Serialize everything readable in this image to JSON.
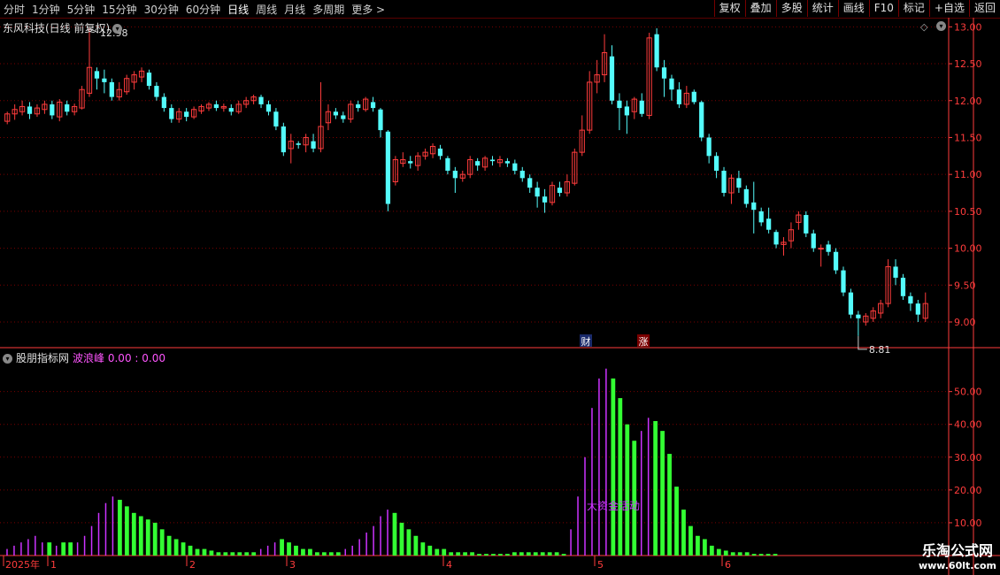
{
  "toolbar": {
    "periods": [
      "分时",
      "1分钟",
      "5分钟",
      "15分钟",
      "30分钟",
      "60分钟",
      "日线",
      "周线",
      "月线",
      "多周期",
      "更多 >"
    ],
    "active_period": "日线",
    "buttons": [
      "复权",
      "叠加",
      "多股",
      "统计",
      "画线",
      "F10",
      "标记",
      "+自选",
      "返回"
    ]
  },
  "stock": {
    "title": "东风科技(日线 前复权)",
    "high_label": "12.98",
    "low_label": "8.81",
    "marker_cai": "财",
    "marker_zhang": "涨"
  },
  "indicator": {
    "name": "股朋指标网",
    "sub": "波浪峰",
    "values": "0.00 : 0.00",
    "annotation": "大资金活动"
  },
  "colors": {
    "up": "#ff3c3c",
    "down": "#54fcfc",
    "axis": "#ff3c3c",
    "grid": "#7a0000",
    "bar_green": "#33ff33",
    "bar_purple": "#cc33ff"
  },
  "chart_data": [
    {
      "type": "candlestick",
      "y_axis": [
        "13.00",
        "12.50",
        "12.00",
        "11.50",
        "11.00",
        "10.50",
        "10.00",
        "9.50",
        "9.00"
      ],
      "ylim": [
        8.7,
        13.1
      ],
      "x_labels": [
        "2025年",
        "1",
        "2",
        "3",
        "4",
        "5",
        "6"
      ],
      "candles": [
        [
          11.72,
          11.82,
          11.68,
          11.85
        ],
        [
          11.82,
          11.88,
          11.74,
          11.95
        ],
        [
          11.85,
          11.92,
          11.8,
          12.0
        ],
        [
          11.92,
          11.82,
          11.75,
          11.98
        ],
        [
          11.82,
          11.9,
          11.78,
          11.95
        ],
        [
          11.88,
          11.95,
          11.82,
          12.0
        ],
        [
          11.95,
          11.8,
          11.75,
          12.0
        ],
        [
          11.78,
          11.98,
          11.72,
          12.02
        ],
        [
          11.95,
          11.85,
          11.8,
          12.0
        ],
        [
          11.85,
          11.92,
          11.8,
          11.96
        ],
        [
          11.9,
          12.15,
          11.88,
          12.2
        ],
        [
          12.1,
          12.45,
          12.05,
          12.98
        ],
        [
          12.4,
          12.3,
          12.15,
          12.45
        ],
        [
          12.3,
          12.25,
          12.1,
          12.42
        ],
        [
          12.25,
          12.05,
          12.0,
          12.3
        ],
        [
          12.05,
          12.15,
          12.0,
          12.25
        ],
        [
          12.12,
          12.3,
          12.08,
          12.35
        ],
        [
          12.25,
          12.35,
          12.15,
          12.4
        ],
        [
          12.32,
          12.4,
          12.25,
          12.45
        ],
        [
          12.38,
          12.2,
          12.15,
          12.42
        ],
        [
          12.2,
          12.05,
          12.0,
          12.25
        ],
        [
          12.05,
          11.9,
          11.85,
          12.1
        ],
        [
          11.9,
          11.75,
          11.7,
          11.95
        ],
        [
          11.75,
          11.85,
          11.7,
          11.9
        ],
        [
          11.85,
          11.78,
          11.72,
          11.9
        ],
        [
          11.78,
          11.88,
          11.75,
          11.92
        ],
        [
          11.86,
          11.92,
          11.82,
          11.95
        ],
        [
          11.9,
          11.95,
          11.86,
          11.98
        ],
        [
          11.95,
          11.9,
          11.86,
          12.0
        ],
        [
          11.9,
          11.92,
          11.85,
          11.96
        ],
        [
          11.9,
          11.85,
          11.8,
          11.95
        ],
        [
          11.85,
          11.95,
          11.82,
          12.0
        ],
        [
          11.95,
          12.0,
          11.9,
          12.05
        ],
        [
          12.0,
          12.05,
          11.95,
          12.08
        ],
        [
          12.05,
          11.95,
          11.9,
          12.08
        ],
        [
          11.95,
          11.85,
          11.8,
          12.0
        ],
        [
          11.85,
          11.65,
          11.6,
          11.9
        ],
        [
          11.65,
          11.3,
          11.25,
          11.7
        ],
        [
          11.35,
          11.45,
          11.15,
          11.55
        ],
        [
          11.42,
          11.4,
          11.35,
          11.45
        ],
        [
          11.4,
          11.5,
          11.3,
          11.55
        ],
        [
          11.45,
          11.35,
          11.3,
          11.55
        ],
        [
          11.35,
          11.65,
          11.3,
          12.25
        ],
        [
          11.7,
          11.85,
          11.6,
          11.95
        ],
        [
          11.85,
          11.8,
          11.75,
          11.9
        ],
        [
          11.8,
          11.75,
          11.7,
          11.85
        ],
        [
          11.75,
          11.95,
          11.7,
          12.0
        ],
        [
          11.95,
          11.9,
          11.85,
          12.0
        ],
        [
          11.88,
          12.02,
          11.85,
          12.05
        ],
        [
          11.98,
          11.9,
          11.85,
          12.05
        ],
        [
          11.88,
          11.6,
          11.5,
          11.9
        ],
        [
          11.58,
          10.6,
          10.5,
          11.6
        ],
        [
          10.9,
          11.2,
          10.85,
          11.25
        ],
        [
          11.15,
          11.2,
          11.1,
          11.3
        ],
        [
          11.18,
          11.15,
          11.08,
          11.25
        ],
        [
          11.12,
          11.25,
          11.05,
          11.3
        ],
        [
          11.25,
          11.3,
          11.2,
          11.35
        ],
        [
          11.28,
          11.38,
          11.22,
          11.42
        ],
        [
          11.35,
          11.25,
          11.2,
          11.4
        ],
        [
          11.22,
          11.05,
          11.0,
          11.25
        ],
        [
          11.05,
          10.95,
          10.75,
          11.1
        ],
        [
          10.95,
          11.0,
          10.9,
          11.05
        ],
        [
          11.0,
          11.2,
          10.95,
          11.25
        ],
        [
          11.18,
          11.12,
          11.05,
          11.22
        ],
        [
          11.1,
          11.22,
          11.05,
          11.25
        ],
        [
          11.2,
          11.18,
          11.12,
          11.25
        ],
        [
          11.16,
          11.2,
          11.1,
          11.25
        ],
        [
          11.18,
          11.15,
          11.1,
          11.22
        ],
        [
          11.15,
          11.05,
          11.0,
          11.2
        ],
        [
          11.05,
          10.95,
          10.9,
          11.1
        ],
        [
          10.95,
          10.82,
          10.75,
          11.0
        ],
        [
          10.82,
          10.7,
          10.55,
          10.9
        ],
        [
          10.7,
          10.62,
          10.48,
          10.8
        ],
        [
          10.62,
          10.85,
          10.58,
          10.9
        ],
        [
          10.82,
          10.75,
          10.7,
          10.9
        ],
        [
          10.75,
          10.9,
          10.7,
          11.0
        ],
        [
          10.88,
          11.3,
          10.85,
          11.35
        ],
        [
          11.3,
          11.6,
          11.25,
          11.8
        ],
        [
          11.6,
          12.25,
          11.55,
          12.4
        ],
        [
          12.25,
          12.35,
          12.1,
          12.55
        ],
        [
          12.35,
          12.65,
          12.25,
          12.9
        ],
        [
          12.6,
          12.0,
          11.95,
          12.75
        ],
        [
          12.0,
          11.9,
          11.6,
          12.1
        ],
        [
          11.92,
          11.8,
          11.55,
          12.0
        ],
        [
          11.85,
          12.02,
          11.75,
          12.05
        ],
        [
          12.0,
          11.82,
          11.78,
          12.1
        ],
        [
          11.8,
          12.85,
          11.75,
          12.92
        ],
        [
          12.9,
          12.45,
          12.4,
          12.98
        ],
        [
          12.45,
          12.3,
          12.05,
          12.55
        ],
        [
          12.3,
          12.15,
          12.0,
          12.35
        ],
        [
          12.15,
          11.95,
          11.9,
          12.25
        ],
        [
          11.95,
          12.1,
          11.9,
          12.2
        ],
        [
          12.12,
          11.98,
          11.95,
          12.15
        ],
        [
          11.98,
          11.5,
          11.45,
          12.0
        ],
        [
          11.5,
          11.25,
          11.15,
          11.55
        ],
        [
          11.25,
          11.05,
          10.95,
          11.3
        ],
        [
          11.05,
          10.75,
          10.7,
          11.1
        ],
        [
          10.75,
          10.95,
          10.6,
          11.0
        ],
        [
          10.95,
          10.82,
          10.75,
          11.05
        ],
        [
          10.8,
          10.6,
          10.55,
          10.85
        ],
        [
          10.62,
          10.52,
          10.2,
          10.9
        ],
        [
          10.5,
          10.35,
          10.3,
          10.55
        ],
        [
          10.4,
          10.25,
          10.2,
          10.55
        ],
        [
          10.22,
          10.05,
          10.0,
          10.25
        ],
        [
          10.05,
          10.08,
          9.9,
          10.15
        ],
        [
          10.1,
          10.25,
          10.0,
          10.35
        ],
        [
          10.35,
          10.45,
          10.25,
          10.5
        ],
        [
          10.45,
          10.2,
          10.15,
          10.5
        ],
        [
          10.2,
          10.0,
          9.95,
          10.25
        ],
        [
          10.0,
          10.0,
          9.75,
          10.05
        ],
        [
          10.05,
          9.95,
          9.9,
          10.1
        ],
        [
          9.95,
          9.7,
          9.65,
          10.0
        ],
        [
          9.7,
          9.4,
          9.35,
          9.75
        ],
        [
          9.4,
          9.1,
          9.05,
          9.45
        ],
        [
          9.1,
          9.05,
          8.81,
          9.15
        ],
        [
          9.0,
          9.08,
          8.95,
          9.12
        ],
        [
          9.05,
          9.15,
          9.0,
          9.2
        ],
        [
          9.12,
          9.25,
          9.05,
          9.3
        ],
        [
          9.25,
          9.75,
          9.2,
          9.85
        ],
        [
          9.75,
          9.6,
          9.5,
          9.85
        ],
        [
          9.6,
          9.35,
          9.3,
          9.65
        ],
        [
          9.35,
          9.25,
          9.15,
          9.4
        ],
        [
          9.25,
          9.1,
          9.0,
          9.3
        ],
        [
          9.05,
          9.25,
          9.0,
          9.4
        ]
      ]
    },
    {
      "type": "bar",
      "y_axis": [
        "50.00",
        "40.00",
        "30.00",
        "20.00",
        "10.00"
      ],
      "ylim": [
        0,
        58
      ],
      "values": [
        {
          "v": 2,
          "c": "p"
        },
        {
          "v": 3,
          "c": "p"
        },
        {
          "v": 4,
          "c": "p"
        },
        {
          "v": 5,
          "c": "p"
        },
        {
          "v": 6,
          "c": "p"
        },
        {
          "v": 4,
          "c": "p"
        },
        {
          "v": 4,
          "c": "g"
        },
        {
          "v": 3,
          "c": "p"
        },
        {
          "v": 4,
          "c": "g"
        },
        {
          "v": 4,
          "c": "g"
        },
        {
          "v": 4,
          "c": "p"
        },
        {
          "v": 6,
          "c": "p"
        },
        {
          "v": 9,
          "c": "p"
        },
        {
          "v": 13,
          "c": "p"
        },
        {
          "v": 16,
          "c": "p"
        },
        {
          "v": 18,
          "c": "p"
        },
        {
          "v": 17,
          "c": "g"
        },
        {
          "v": 15,
          "c": "g"
        },
        {
          "v": 13,
          "c": "g"
        },
        {
          "v": 12,
          "c": "g"
        },
        {
          "v": 11,
          "c": "g"
        },
        {
          "v": 10,
          "c": "g"
        },
        {
          "v": 8,
          "c": "g"
        },
        {
          "v": 6,
          "c": "g"
        },
        {
          "v": 5,
          "c": "g"
        },
        {
          "v": 4,
          "c": "g"
        },
        {
          "v": 3,
          "c": "g"
        },
        {
          "v": 2,
          "c": "g"
        },
        {
          "v": 2,
          "c": "g"
        },
        {
          "v": 1.5,
          "c": "g"
        },
        {
          "v": 1,
          "c": "g"
        },
        {
          "v": 1,
          "c": "g"
        },
        {
          "v": 1,
          "c": "g"
        },
        {
          "v": 1,
          "c": "g"
        },
        {
          "v": 1,
          "c": "g"
        },
        {
          "v": 1,
          "c": "g"
        },
        {
          "v": 2,
          "c": "p"
        },
        {
          "v": 3,
          "c": "p"
        },
        {
          "v": 4,
          "c": "p"
        },
        {
          "v": 5,
          "c": "g"
        },
        {
          "v": 4,
          "c": "g"
        },
        {
          "v": 3,
          "c": "g"
        },
        {
          "v": 2,
          "c": "g"
        },
        {
          "v": 2,
          "c": "g"
        },
        {
          "v": 1,
          "c": "g"
        },
        {
          "v": 1,
          "c": "g"
        },
        {
          "v": 1,
          "c": "g"
        },
        {
          "v": 1,
          "c": "g"
        },
        {
          "v": 2,
          "c": "p"
        },
        {
          "v": 3,
          "c": "p"
        },
        {
          "v": 5,
          "c": "p"
        },
        {
          "v": 7,
          "c": "p"
        },
        {
          "v": 9,
          "c": "p"
        },
        {
          "v": 12,
          "c": "p"
        },
        {
          "v": 14,
          "c": "p"
        },
        {
          "v": 13,
          "c": "g"
        },
        {
          "v": 10,
          "c": "g"
        },
        {
          "v": 8,
          "c": "g"
        },
        {
          "v": 6,
          "c": "g"
        },
        {
          "v": 4,
          "c": "g"
        },
        {
          "v": 3,
          "c": "g"
        },
        {
          "v": 2,
          "c": "g"
        },
        {
          "v": 2,
          "c": "g"
        },
        {
          "v": 1,
          "c": "g"
        },
        {
          "v": 1,
          "c": "g"
        },
        {
          "v": 1,
          "c": "g"
        },
        {
          "v": 1,
          "c": "g"
        },
        {
          "v": 0.5,
          "c": "g"
        },
        {
          "v": 0.5,
          "c": "g"
        },
        {
          "v": 0.5,
          "c": "g"
        },
        {
          "v": 0.5,
          "c": "g"
        },
        {
          "v": 0.5,
          "c": "g"
        },
        {
          "v": 1,
          "c": "g"
        },
        {
          "v": 1,
          "c": "g"
        },
        {
          "v": 1,
          "c": "g"
        },
        {
          "v": 1,
          "c": "g"
        },
        {
          "v": 1,
          "c": "g"
        },
        {
          "v": 1,
          "c": "g"
        },
        {
          "v": 1,
          "c": "g"
        },
        {
          "v": 0.5,
          "c": "g"
        },
        {
          "v": 8,
          "c": "p"
        },
        {
          "v": 18,
          "c": "p"
        },
        {
          "v": 30,
          "c": "p"
        },
        {
          "v": 45,
          "c": "p"
        },
        {
          "v": 54,
          "c": "p"
        },
        {
          "v": 57,
          "c": "p"
        },
        {
          "v": 54,
          "c": "g"
        },
        {
          "v": 48,
          "c": "g"
        },
        {
          "v": 40,
          "c": "g"
        },
        {
          "v": 35,
          "c": "g"
        },
        {
          "v": 38,
          "c": "p"
        },
        {
          "v": 42,
          "c": "p"
        },
        {
          "v": 41,
          "c": "g"
        },
        {
          "v": 38,
          "c": "g"
        },
        {
          "v": 31,
          "c": "g"
        },
        {
          "v": 21,
          "c": "g"
        },
        {
          "v": 14,
          "c": "g"
        },
        {
          "v": 9,
          "c": "g"
        },
        {
          "v": 6,
          "c": "g"
        },
        {
          "v": 5,
          "c": "g"
        },
        {
          "v": 3,
          "c": "g"
        },
        {
          "v": 2,
          "c": "g"
        },
        {
          "v": 1.5,
          "c": "g"
        },
        {
          "v": 1,
          "c": "g"
        },
        {
          "v": 1,
          "c": "g"
        },
        {
          "v": 1,
          "c": "g"
        },
        {
          "v": 0.5,
          "c": "g"
        },
        {
          "v": 0.5,
          "c": "g"
        },
        {
          "v": 0.5,
          "c": "g"
        },
        {
          "v": 0.5,
          "c": "g"
        }
      ]
    }
  ],
  "watermark": {
    "line1": "乐淘公式网",
    "line2": "www.60lt.com"
  }
}
